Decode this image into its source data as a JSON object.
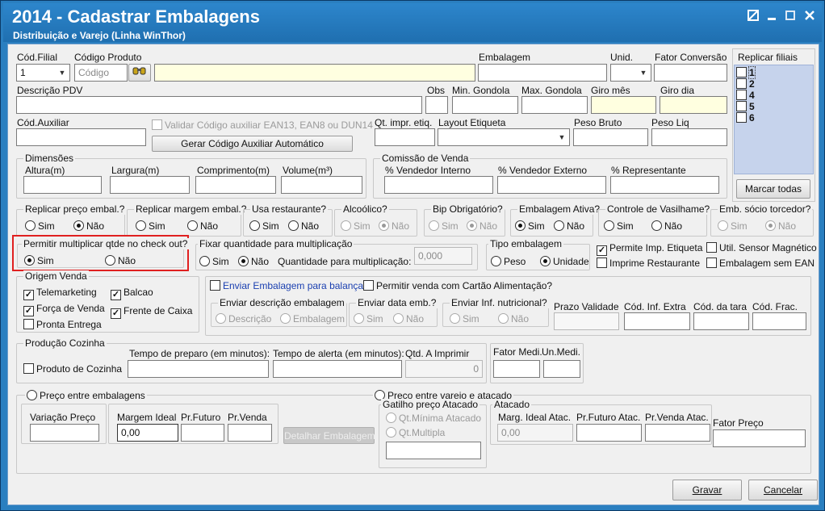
{
  "window": {
    "title": "2014 - Cadastrar Embalagens",
    "subtitle": "Distribuição e Varejo (Linha WinThor)"
  },
  "icons": {
    "restore": "restore-icon",
    "minimize": "minimize-icon",
    "maximize": "maximize-icon",
    "close": "close-icon",
    "search": "search-binoculars-icon"
  },
  "row1": {
    "cod_filial_label": "Cód.Filial",
    "cod_filial_value": "1",
    "codigo_produto_label": "Código Produto",
    "codigo_placeholder": "Código",
    "embalagem_label": "Embalagem",
    "unid_label": "Unid.",
    "fator_conversao_label": "Fator Conversão"
  },
  "replicar_filiais": {
    "label": "Replicar filiais",
    "items": [
      "1",
      "2",
      "4",
      "5",
      "6"
    ],
    "button": "Marcar todas"
  },
  "row2": {
    "descricao_label": "Descrição PDV",
    "obs_label": "Obs",
    "min_gondola_label": "Min. Gondola",
    "max_gondola_label": "Max. Gondola",
    "giro_mes_label": "Giro mês",
    "giro_dia_label": "Giro dia"
  },
  "row3": {
    "cod_auxiliar_label": "Cód.Auxiliar",
    "validar_label": "Validar Código auxiliar EAN13, EAN8 ou DUN14",
    "gerar_button": "Gerar Código Auxiliar Automático",
    "qt_impr_label": "Qt. impr. etiq.",
    "layout_label": "Layout Etiqueta",
    "peso_bruto_label": "Peso Bruto",
    "peso_liq_label": "Peso Liq"
  },
  "dimensoes": {
    "title": "Dimensões",
    "altura": "Altura(m)",
    "largura": "Largura(m)",
    "comprimento": "Comprimento(m)",
    "volume": "Volume(m³)"
  },
  "comissao": {
    "title": "Comissão de Venda",
    "vendedor_interno": "% Vendedor Interno",
    "vendedor_externo": "% Vendedor Externo",
    "representante": "% Representante"
  },
  "options": {
    "replicar_preco": {
      "title": "Replicar preço embal.?",
      "sim": "Sim",
      "nao": "Não"
    },
    "replicar_margem": {
      "title": "Replicar margem embal.?",
      "sim": "Sim",
      "nao": "Não"
    },
    "usa_restaurante": {
      "title": "Usa restaurante?",
      "sim": "Sim",
      "nao": "Não"
    },
    "alcoolico": {
      "title": "Alcoólico?",
      "sim": "Sim",
      "nao": "Não"
    },
    "bip": {
      "title": "Bip Obrigatório?",
      "sim": "Sim",
      "nao": "Não"
    },
    "embalagem_ativa": {
      "title": "Embalagem Ativa?",
      "sim": "Sim",
      "nao": "Não"
    },
    "vasilhame": {
      "title": "Controle de Vasilhame?",
      "sim": "Sim",
      "nao": "Não"
    },
    "socio": {
      "title": "Emb. sócio torcedor?",
      "sim": "Sim",
      "nao": "Não"
    }
  },
  "multiplicar": {
    "title": "Permitir multiplicar qtde no check out?",
    "sim": "Sim",
    "nao": "Não",
    "highlight_color": "#e02020"
  },
  "fixar": {
    "title": "Fixar quantidade para multiplicação",
    "sim": "Sim",
    "nao": "Não",
    "qtd_label": "Quantidade para multiplicação:",
    "qtd_value": "0,000"
  },
  "tipo_embalagem": {
    "title": "Tipo embalagem",
    "peso": "Peso",
    "unidade": "Unidade"
  },
  "checks_right": {
    "permite_imp": "Permite Imp. Etiqueta",
    "util_sensor": "Util. Sensor Magnético",
    "imprime_rest": "Imprime Restaurante",
    "sem_ean": "Embalagem sem EAN"
  },
  "origem_venda": {
    "title": "Origem Venda",
    "telemarketing": "Telemarketing",
    "balcao": "Balcao",
    "forca_venda": "Força de Venda",
    "frente_caixa": "Frente de Caixa",
    "pronta_entrega": "Pronta Entrega"
  },
  "balanca": {
    "enviar_label": "Enviar Embalagem para balança",
    "cartao_label": "Permitir venda com Cartão Alimentação?",
    "desc_title": "Enviar descrição embalagem",
    "descricao": "Descrição",
    "embalagem": "Embalagem",
    "data_title": "Enviar data emb.?",
    "inf_title": "Enviar Inf. nutricional?",
    "sim": "Sim",
    "nao": "Não",
    "prazo_validade": "Prazo Validade",
    "cod_inf_extra": "Cód. Inf. Extra",
    "cod_tara": "Cód. da tara",
    "cod_frac": "Cód. Frac.",
    "link_color": "#1a3fb0"
  },
  "producao": {
    "title": "Produção Cozinha",
    "produto_cozinha": "Produto de Cozinha",
    "tempo_preparo": "Tempo de preparo (em minutos):",
    "tempo_alerta": "Tempo de alerta (em minutos):",
    "qtd_imprimir": "Qtd. A Imprimir",
    "qtd_value": "0",
    "fator_medi": "Fator Medi.",
    "un_medi": "Un.Medi."
  },
  "preco": {
    "entre_embalagens": "Preço entre embalagens",
    "variacao": "Variação Preço",
    "margem_ideal": "Margem Ideal",
    "margem_value": "0,00",
    "pr_futuro": "Pr.Futuro",
    "pr_venda": "Pr.Venda",
    "detalhar": "Detalhar Embalagem",
    "entre_varejo": "Preço entre varejo e atacado",
    "gatilho_title": "Gatilho preço Atacado",
    "qt_minima": "Qt.Mínima Atacado",
    "qt_multipla": "Qt.Multipla",
    "atacado_title": "Atacado",
    "marg_ideal_atac": "Marg. Ideal Atac.",
    "marg_value": "0,00",
    "pr_futuro_atac": "Pr.Futuro Atac.",
    "pr_venda_atac": "Pr.Venda Atac.",
    "fator_preco": "Fator Preço"
  },
  "actions": {
    "gravar": "Gravar",
    "cancelar": "Cancelar"
  }
}
